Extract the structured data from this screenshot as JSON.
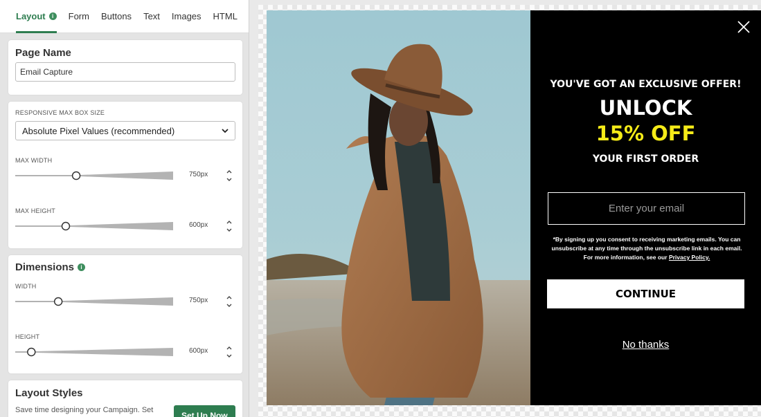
{
  "tabs": [
    {
      "label": "Layout",
      "active": true
    },
    {
      "label": "Form"
    },
    {
      "label": "Buttons"
    },
    {
      "label": "Text"
    },
    {
      "label": "Images"
    },
    {
      "label": "HTML"
    }
  ],
  "info_glyph": "i",
  "page_name": {
    "title": "Page Name",
    "value": "Email Capture"
  },
  "responsive": {
    "label": "RESPONSIVE MAX BOX SIZE",
    "select_value": "Absolute Pixel Values (recommended)",
    "max_width": {
      "label": "MAX WIDTH",
      "value": "750px",
      "fraction": 0.38
    },
    "max_height": {
      "label": "MAX HEIGHT",
      "value": "600px",
      "fraction": 0.31
    }
  },
  "dimensions": {
    "title": "Dimensions",
    "width": {
      "label": "WIDTH",
      "value": "750px",
      "fraction": 0.26
    },
    "height": {
      "label": "HEIGHT",
      "value": "600px",
      "fraction": 0.08
    }
  },
  "layout_styles": {
    "title": "Layout Styles",
    "description": "Save time designing your Campaign. Set",
    "button": "Set Up Now"
  },
  "popup": {
    "headline1": "YOU'VE GOT AN EXCLUSIVE OFFER!",
    "headline2": "UNLOCK",
    "headline3": "15% OFF",
    "headline4": "YOUR FIRST ORDER",
    "email_placeholder": "Enter your email",
    "consent_text": "*By signing up you consent to receiving marketing emails. You can unsubscribe at any time through the unsubscribe link in each email. For more information, see our",
    "privacy_link": "Privacy Policy.",
    "continue": "CONTINUE",
    "no_thanks": "No thanks"
  },
  "colors": {
    "accent": "#2e7d50",
    "offer_highlight": "#f5eb18",
    "popup_bg": "#000000"
  },
  "icons": {
    "close": "close-icon",
    "stepper": "stepper-icon",
    "select_arrow": "chevron-down-icon",
    "info": "info-icon"
  }
}
